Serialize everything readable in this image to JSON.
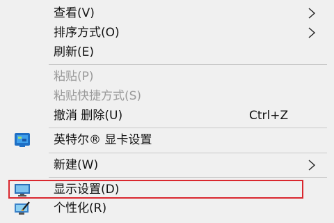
{
  "context_menu": {
    "items": [
      {
        "label": "查看(V)",
        "has_submenu": true
      },
      {
        "label": "排序方式(O)",
        "has_submenu": true
      },
      {
        "label": "刷新(E)"
      },
      {
        "label": "粘贴(P)",
        "disabled": true
      },
      {
        "label": "粘贴快捷方式(S)",
        "disabled": true
      },
      {
        "label": "撤消 删除(U)",
        "shortcut": "Ctrl+Z"
      },
      {
        "label": "英特尔® 显卡设置",
        "icon": "intel-graphics-icon"
      },
      {
        "label": "新建(W)",
        "has_submenu": true
      },
      {
        "label": "显示设置(D)",
        "icon": "display-settings-icon",
        "highlighted": true
      },
      {
        "label": "个性化(R)",
        "icon": "personalize-icon"
      }
    ]
  },
  "colors": {
    "background": "#f0f0f0",
    "disabled_text": "#9a9a9a",
    "highlight_border": "#d9272e",
    "separator": "#c8c8c8"
  }
}
